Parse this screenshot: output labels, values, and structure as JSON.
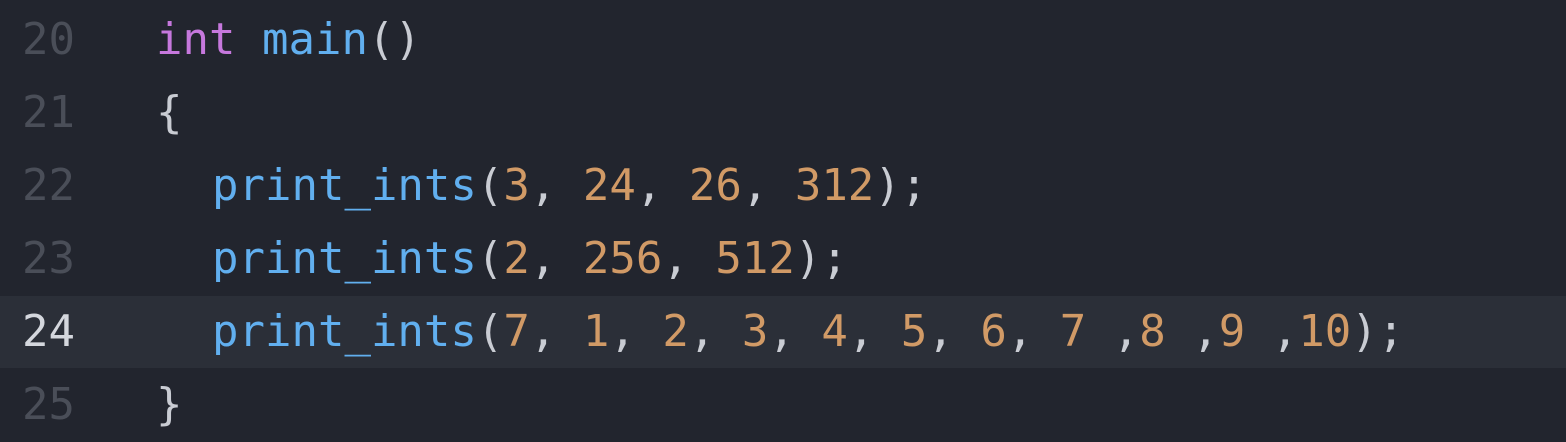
{
  "editor": {
    "lines": [
      {
        "number": "20",
        "tokens": [
          "int",
          "main",
          "()"
        ]
      },
      {
        "number": "21",
        "tokens": [
          "{"
        ]
      },
      {
        "number": "22",
        "tokens": [
          "print_ints",
          "(",
          "3",
          ", ",
          "24",
          ", ",
          "26",
          ", ",
          "312",
          ");"
        ]
      },
      {
        "number": "23",
        "tokens": [
          "print_ints",
          "(",
          "2",
          ", ",
          "256",
          ", ",
          "512",
          ");"
        ]
      },
      {
        "number": "24",
        "tokens": [
          "print_ints",
          "(",
          "7",
          ", ",
          "1",
          ", ",
          "2",
          ", ",
          "3",
          ", ",
          "4",
          ", ",
          "5",
          ", ",
          "6",
          ", ",
          "7",
          " ,",
          "8",
          " ,",
          "9",
          " ,",
          "10",
          ");"
        ]
      },
      {
        "number": "25",
        "tokens": [
          "}"
        ]
      }
    ],
    "active_line": "24",
    "colors": {
      "background": "#22252e",
      "keyword": "#c678dd",
      "function": "#61afef",
      "number": "#d19a66",
      "punctuation": "#c9ccd3",
      "gutter": "#4a4e58"
    }
  }
}
